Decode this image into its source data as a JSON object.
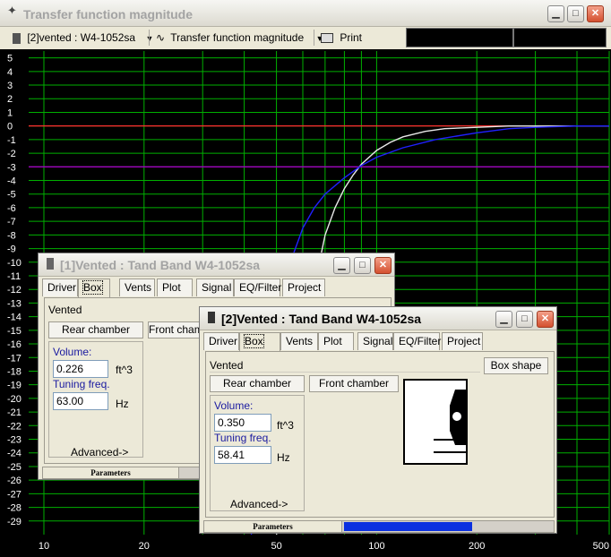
{
  "main_window": {
    "title": "Transfer function magnitude",
    "toolbar": {
      "box_selector": "[2]vented : W4-1052sa",
      "plot_selector": "Transfer function magnitude",
      "print_label": "Print"
    },
    "colors": {
      "background": "#000000",
      "grid": "#00b000",
      "axis_text": "#ffffff",
      "ref_0db": "#ff3030",
      "ref_minus3db": "#a000c0",
      "curve_1": "#e8e8e8",
      "curve_2": "#2020ff"
    }
  },
  "chart_data": {
    "type": "line",
    "xscale": "log",
    "xlim": [
      9,
      500
    ],
    "ylim": [
      -30,
      5.5
    ],
    "xticks": [
      10,
      20,
      50,
      100,
      200,
      500
    ],
    "yticks": [
      5,
      4,
      3,
      2,
      1,
      0,
      -1,
      -2,
      -3,
      -4,
      -5,
      -6,
      -7,
      -8,
      -9,
      -10,
      -11,
      -12,
      -13,
      -14,
      -15,
      -16,
      -17,
      -18,
      -19,
      -20,
      -21,
      -22,
      -23,
      -24,
      -25,
      -26,
      -27,
      -28,
      -29
    ],
    "reference_lines": [
      {
        "y": 0,
        "color": "#ff3030"
      },
      {
        "y": -3,
        "color": "#a000c0"
      }
    ],
    "series": [
      {
        "color": "#e8e8e8",
        "x": [
          50,
          55,
          60,
          63,
          66,
          70,
          75,
          80,
          85,
          90,
          100,
          110,
          120,
          140,
          160,
          200,
          250,
          300,
          400,
          500
        ],
        "y": [
          -30,
          -24.5,
          -18,
          -14,
          -11,
          -8,
          -6,
          -4.6,
          -3.6,
          -2.8,
          -1.8,
          -1.2,
          -0.8,
          -0.4,
          -0.2,
          -0.1,
          0,
          0,
          0,
          0
        ]
      },
      {
        "color": "#2020ff",
        "x": [
          42,
          44,
          47,
          50,
          53,
          56,
          60,
          65,
          70,
          80,
          90,
          100,
          120,
          150,
          200,
          250,
          300,
          400,
          500
        ],
        "y": [
          -30,
          -27,
          -21,
          -16,
          -12,
          -9.5,
          -7.5,
          -6,
          -5,
          -3.8,
          -2.9,
          -2.3,
          -1.6,
          -1,
          -0.5,
          -0.2,
          -0.1,
          0,
          0
        ]
      }
    ]
  },
  "box1_window": {
    "title": "[1]Vented : Tand Band W4-1052sa",
    "tabs": [
      "Driver",
      "Box",
      "Vents",
      "Plot",
      "Signal",
      "EQ/Filter",
      "Project"
    ],
    "active_tab": "Box",
    "box_type": "Vented",
    "rear_chamber": "Rear chamber",
    "front_chamber": "Front chamber",
    "volume_label": "Volume:",
    "volume_value": "0.226",
    "volume_unit": "ft^3",
    "tuning_label": "Tuning freq.",
    "tuning_value": "63.00",
    "tuning_unit": "Hz",
    "advanced": "Advanced->",
    "status": "Parameters"
  },
  "box2_window": {
    "title": "[2]Vented : Tand Band W4-1052sa",
    "tabs": [
      "Driver",
      "Box",
      "Vents",
      "Plot",
      "Signal",
      "EQ/Filter",
      "Project"
    ],
    "active_tab": "Box",
    "box_type": "Vented",
    "box_shape": "Box shape",
    "rear_chamber": "Rear chamber",
    "front_chamber": "Front chamber",
    "volume_label": "Volume:",
    "volume_value": "0.350",
    "volume_unit": "ft^3",
    "tuning_label": "Tuning freq.",
    "tuning_value": "58.41",
    "tuning_unit": "Hz",
    "advanced": "Advanced->",
    "status": "Parameters",
    "progress_fraction": 0.61,
    "progress_color": "#0a2fe0"
  }
}
